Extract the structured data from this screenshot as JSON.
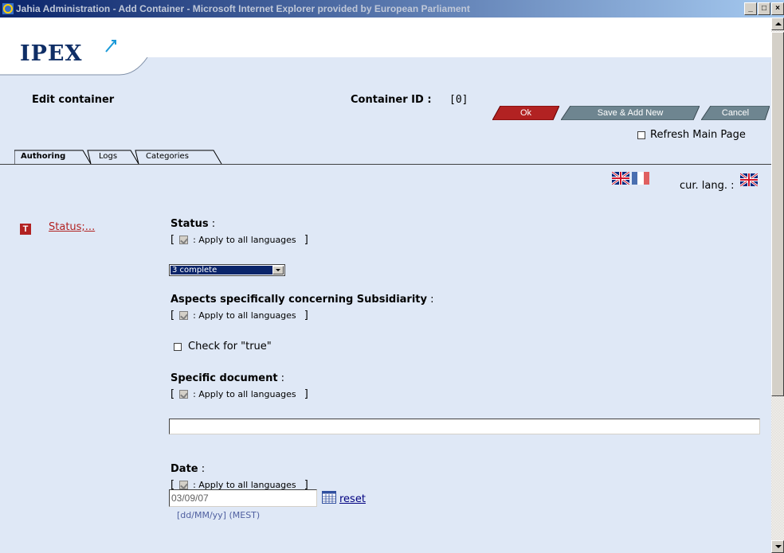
{
  "window": {
    "title": "Jahia Administration - Add Container - Microsoft Internet Explorer provided by European Parliament",
    "min": "_",
    "max": "□",
    "close": "×"
  },
  "header": {
    "logo": "IPEX",
    "edit_title": "Edit container",
    "container_id_label": "Container ID :",
    "container_id_value": "[0]"
  },
  "toolbar": {
    "ok_label": "Ok",
    "save_add_new_label": "Save & Add New",
    "cancel_label": "Cancel",
    "refresh_label": "Refresh Main Page",
    "refresh_checked": false
  },
  "tabs": [
    {
      "label": "Authoring",
      "active": true
    },
    {
      "label": "Logs",
      "active": false
    },
    {
      "label": "Categories",
      "active": false
    }
  ],
  "language": {
    "cur_lang_label": "cur. lang. :",
    "flags": [
      "uk-flag-icon",
      "france-flag-icon"
    ]
  },
  "sidebar": {
    "status_link": "Status;..."
  },
  "fields": {
    "status": {
      "label": "Status",
      "suffix": " :",
      "apply": ": Apply to all languages",
      "select_value": "3 complete"
    },
    "subsidiarity": {
      "label": "Aspects specifically concerning Subsidiarity",
      "suffix": " :",
      "apply": ": Apply to all languages",
      "check_label": "Check for \"true\""
    },
    "specific_document": {
      "label": "Specific document",
      "suffix": " :",
      "apply": ": Apply to all languages",
      "value": ""
    },
    "date": {
      "label": "Date",
      "suffix": " :",
      "apply": ": Apply to all languages",
      "value": "03/09/07",
      "reset_label": "reset",
      "format_hint": "[dd/MM/yy] (MEST)"
    }
  },
  "colors": {
    "content_bg": "#dfe8f6",
    "ok_button": "#b22222",
    "grey_button": "#6e8590",
    "title_gradient_start": "#0a246a"
  }
}
